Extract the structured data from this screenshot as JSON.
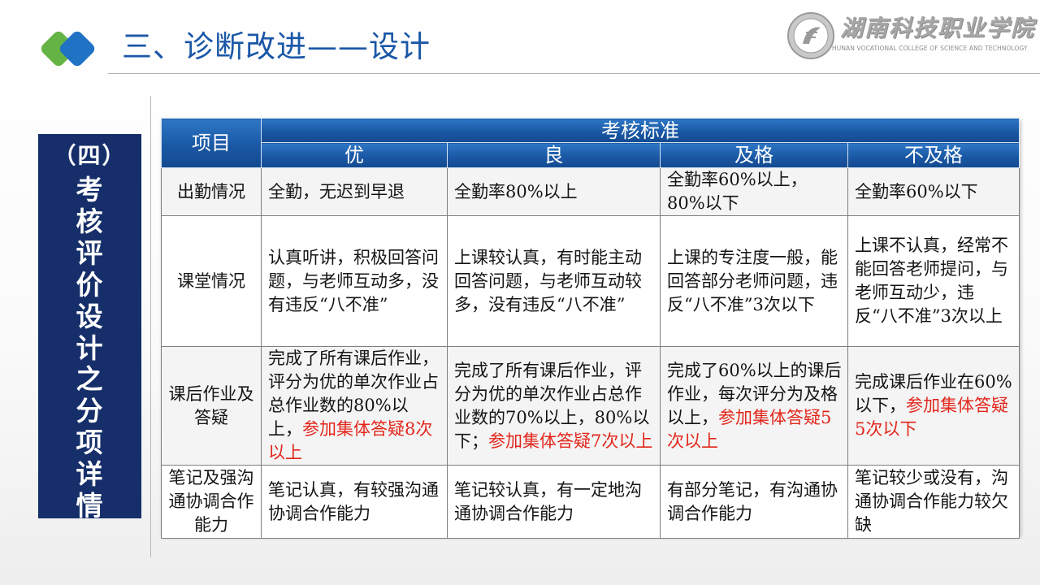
{
  "header": {
    "title": "三、诊断改进——设计",
    "logo": {
      "name_cn": "湖南科技职业学院",
      "name_en": "HUNAN VOCATIONAL COLLEGE OF SCIENCE AND TECHNOLOGY"
    }
  },
  "side_panel": {
    "heading": "（四）",
    "body": "考核评价设计之分项详情"
  },
  "table": {
    "row_header_label": "项目",
    "group_header": "考核标准",
    "levels": [
      "优",
      "良",
      "及格",
      "不及格"
    ],
    "rows": [
      {
        "label": "出勤情况",
        "cells": [
          {
            "text": "全勤，无迟到早退",
            "red": ""
          },
          {
            "text": "全勤率80%以上",
            "red": ""
          },
          {
            "text": "全勤率60%以上，80%以下",
            "red": ""
          },
          {
            "text": "全勤率60%以下",
            "red": ""
          }
        ]
      },
      {
        "label": "课堂情况",
        "cells": [
          {
            "text": "认真听讲，积极回答问题，与老师互动多，没有违反“八不准”",
            "red": ""
          },
          {
            "text": "上课较认真，有时能主动回答问题，与老师互动较多，没有违反“八不准”",
            "red": ""
          },
          {
            "text": "上课的专注度一般，能回答部分老师问题，违反“八不准”3次以下",
            "red": ""
          },
          {
            "text": "上课不认真，经常不能回答老师提问，与老师互动少，违反“八不准”3次以上",
            "red": ""
          }
        ]
      },
      {
        "label": "课后作业及答疑",
        "cells": [
          {
            "text": "完成了所有课后作业，评分为优的单次作业占总作业数的80%以上，",
            "red": "参加集体答疑8次以上"
          },
          {
            "text": "完成了所有课后作业，评分为优的单次作业占总作业数的70%以上，80%以下；",
            "red": "参加集体答疑7次以上"
          },
          {
            "text": "完成了60%以上的课后作业，每次评分为及格以上，",
            "red": "参加集体答疑5次以上"
          },
          {
            "text": "完成课后作业在60%以下，",
            "red": "参加集体答疑5次以下"
          }
        ]
      },
      {
        "label": "笔记及强沟通协调合作能力",
        "cells": [
          {
            "text": "笔记认真，有较强沟通协调合作能力",
            "red": ""
          },
          {
            "text": "笔记较认真，有一定地沟通协调合作能力",
            "red": ""
          },
          {
            "text": "有部分笔记，有沟通协调合作能力",
            "red": ""
          },
          {
            "text": "笔记较少或没有，沟通协调合作能力较欠缺",
            "red": ""
          }
        ]
      }
    ]
  },
  "colors": {
    "title_blue": "#1a57a7",
    "panel_navy": "#162f6a",
    "header_blue": "#1f5fae",
    "highlight_red": "#e2261b",
    "icon_green": "#66b345",
    "icon_blue": "#1f72c4"
  }
}
